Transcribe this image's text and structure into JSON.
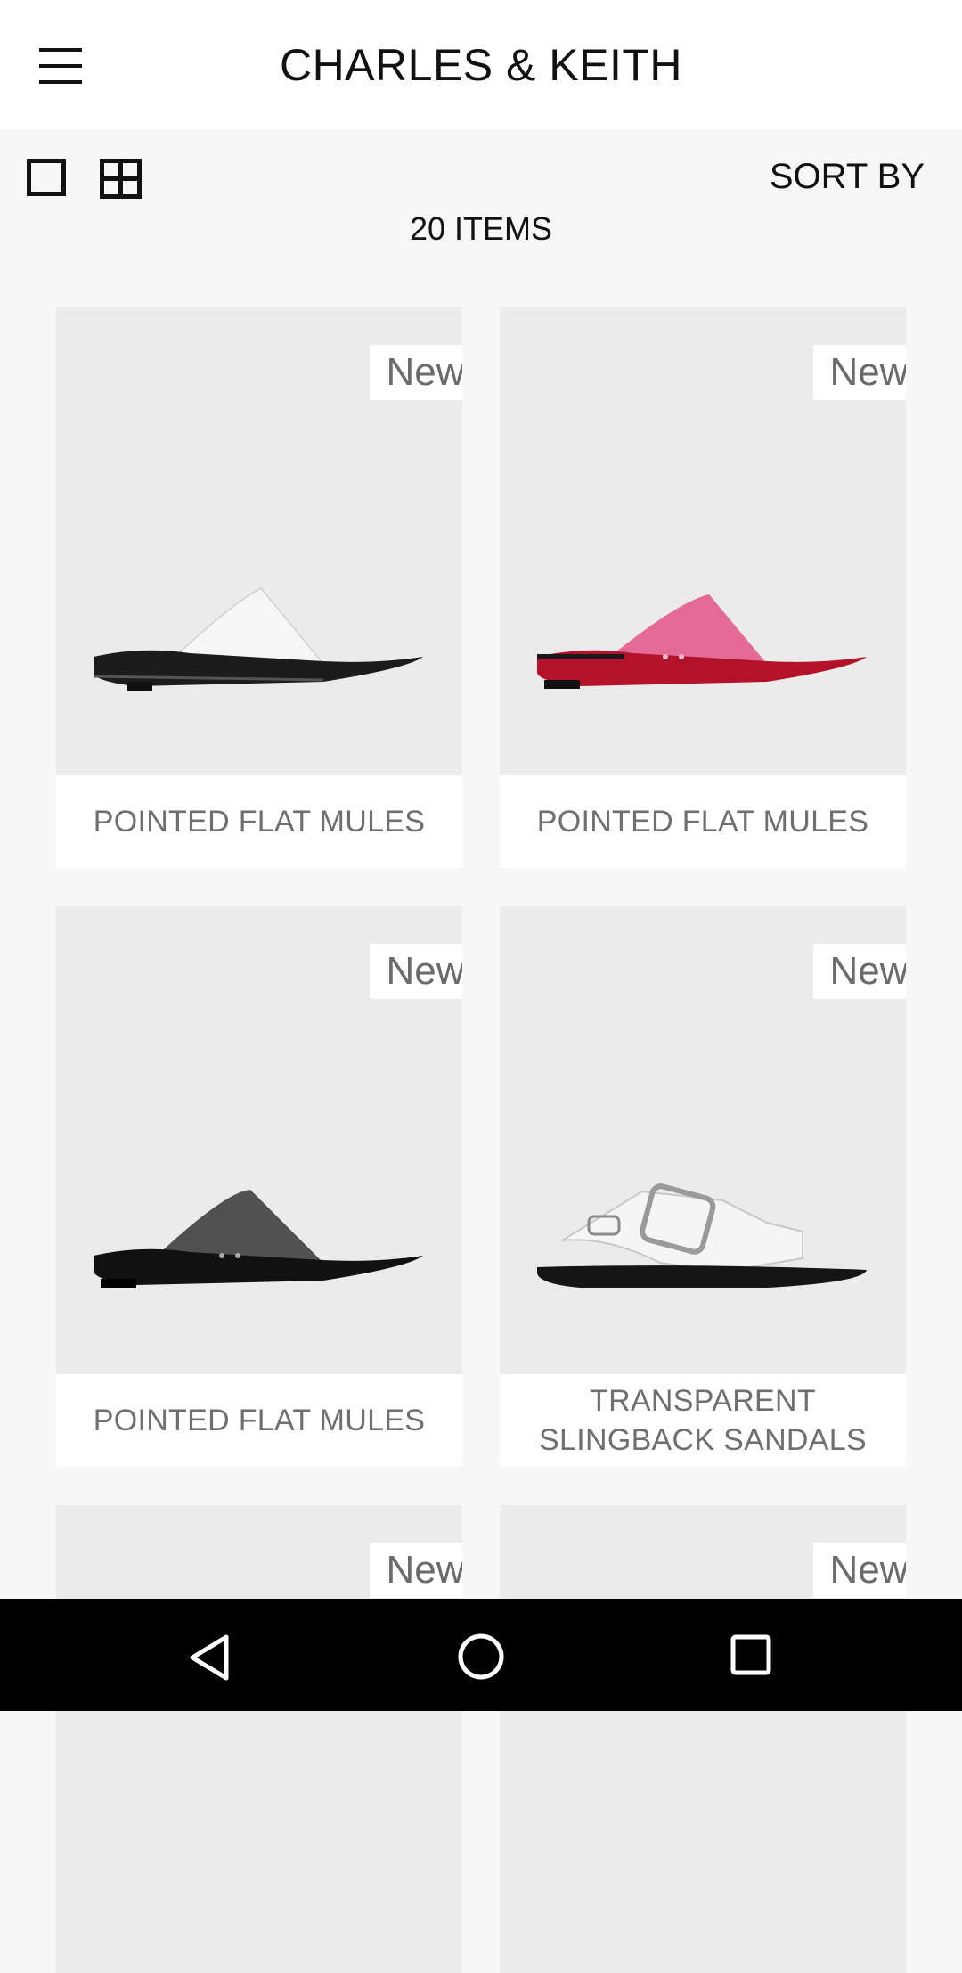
{
  "header": {
    "title": "CHARLES & KEITH",
    "menu_icon": "hamburger-menu-icon"
  },
  "toolbar": {
    "view_single_icon": "single-view-icon",
    "view_grid_icon": "grid-view-icon",
    "sort_label": "SORT BY",
    "item_count": "20 ITEMS"
  },
  "products": [
    {
      "badge": "New",
      "name": "POINTED FLAT MULES",
      "color": "#1c1c1c"
    },
    {
      "badge": "New",
      "name": "POINTED FLAT MULES",
      "color": "#b3122a"
    },
    {
      "badge": "New",
      "name": "POINTED FLAT MULES",
      "color": "#1c1c1c"
    },
    {
      "badge": "New",
      "name": "TRANSPARENT SLINGBACK SANDALS",
      "color": "#1c1c1c"
    },
    {
      "badge": "New",
      "name": ""
    },
    {
      "badge": "New",
      "name": ""
    }
  ],
  "navbar": {
    "back_icon": "back-icon",
    "home_icon": "home-icon",
    "recents_icon": "recents-icon"
  },
  "colors": {
    "header_bg": "#ffffff",
    "page_bg": "#f7f7f7",
    "card_image_bg": "#ebebeb",
    "badge_text": "#6b6b6b",
    "nav_bg": "#000000"
  }
}
